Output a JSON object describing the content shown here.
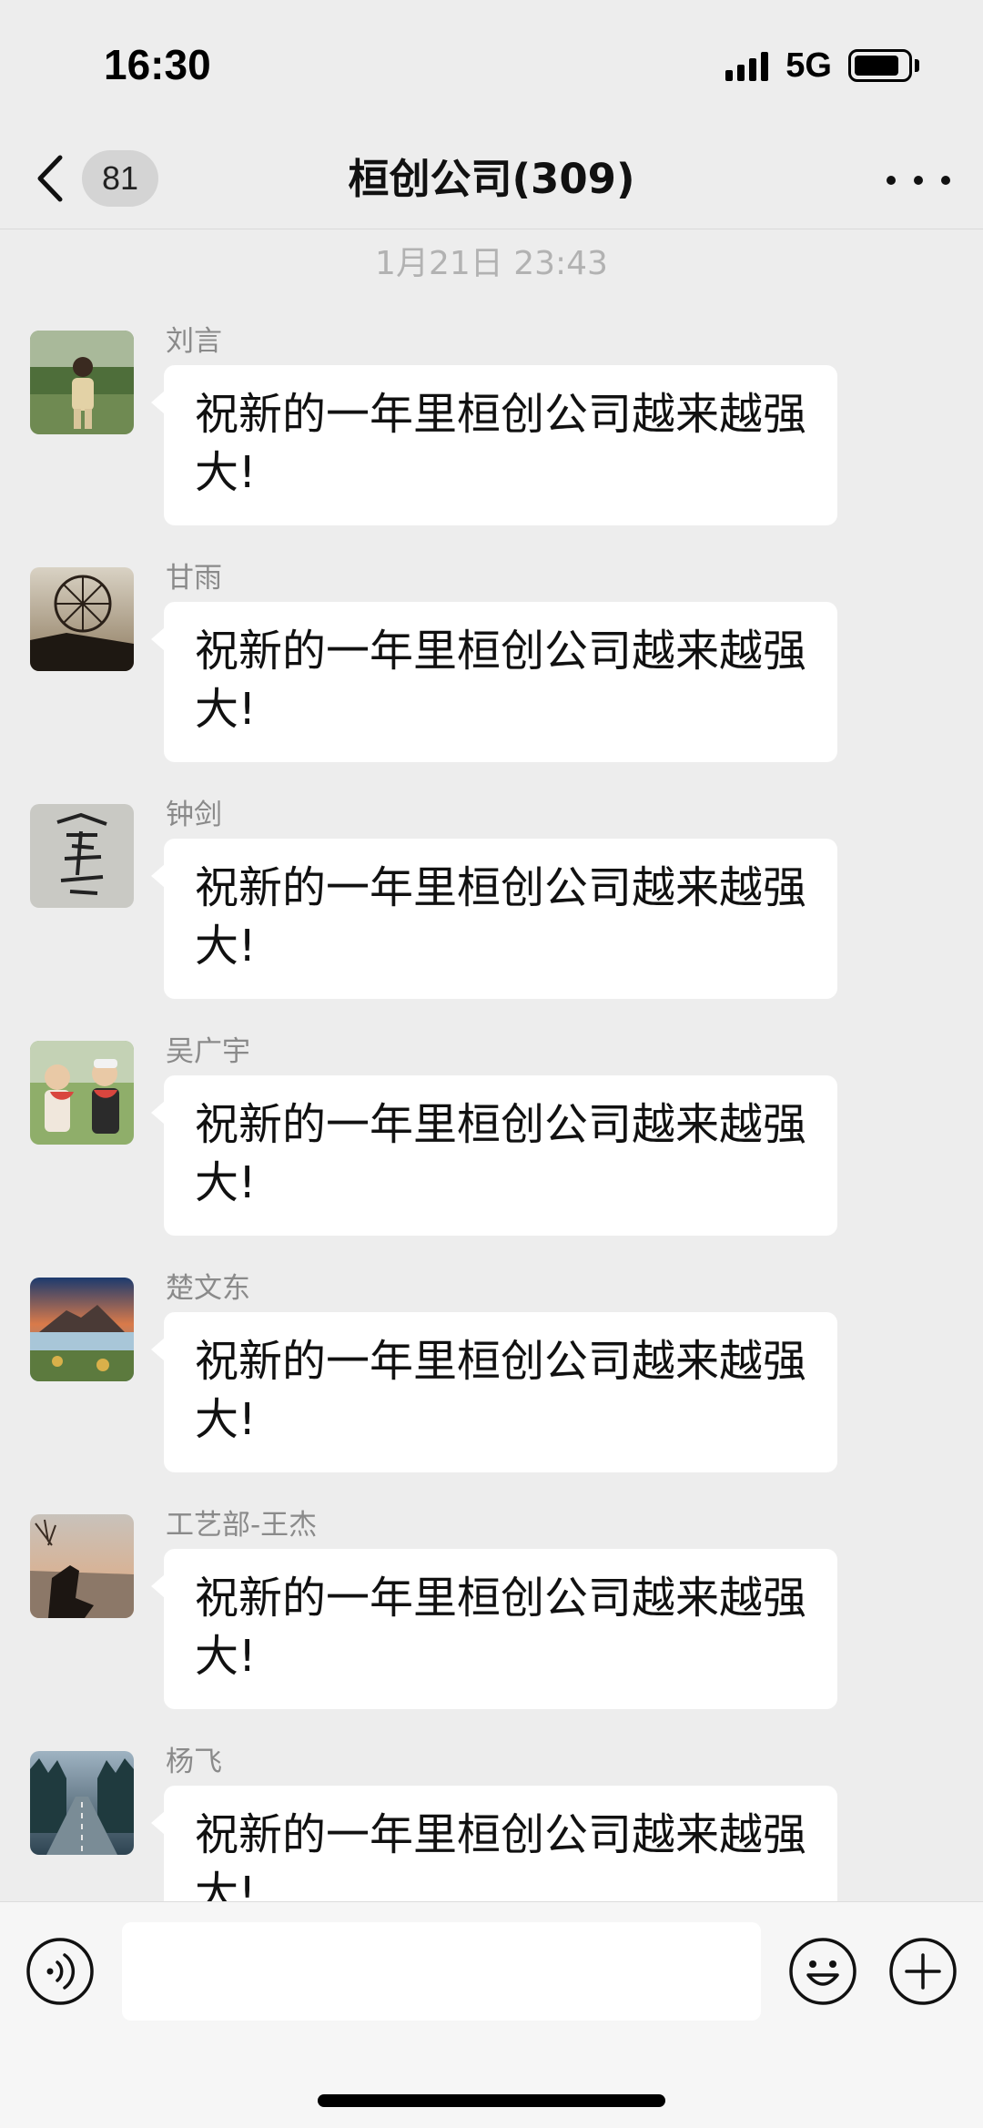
{
  "status_bar": {
    "time": "16:30",
    "network": "5G",
    "signal_icon": "cellular-signal-icon",
    "battery_icon": "battery-icon",
    "battery_level": 0.85
  },
  "nav": {
    "back_icon": "chevron-left-icon",
    "unread_count": "81",
    "title": "桓创公司(309)",
    "more_icon": "more-dots-icon"
  },
  "chat": {
    "timestamp": "1月21日 23:43",
    "messages": [
      {
        "sender": "刘言",
        "text": "祝新的一年里桓创公司越来越强大!",
        "avatar": "child-in-field-avatar"
      },
      {
        "sender": "甘雨",
        "text": "祝新的一年里桓创公司越来越强大!",
        "avatar": "ferris-wheel-avatar"
      },
      {
        "sender": "钟剑",
        "text": "祝新的一年里桓创公司越来越强大!",
        "avatar": "calligraphy-avatar"
      },
      {
        "sender": "吴广宇",
        "text": "祝新的一年里桓创公司越来越强大!",
        "avatar": "kids-watermelon-avatar"
      },
      {
        "sender": "楚文东",
        "text": "祝新的一年里桓创公司越来越强大!",
        "avatar": "volcano-landscape-avatar"
      },
      {
        "sender": "工艺部-王杰",
        "text": "祝新的一年里桓创公司越来越强大!",
        "avatar": "sunset-silhouette-avatar"
      },
      {
        "sender": "杨飞",
        "text": "祝新的一年里桓创公司越来越强大!",
        "avatar": "forest-road-avatar"
      }
    ]
  },
  "input_bar": {
    "voice_icon": "voice-icon",
    "message_value": "",
    "emoji_icon": "emoji-icon",
    "plus_icon": "plus-icon"
  }
}
